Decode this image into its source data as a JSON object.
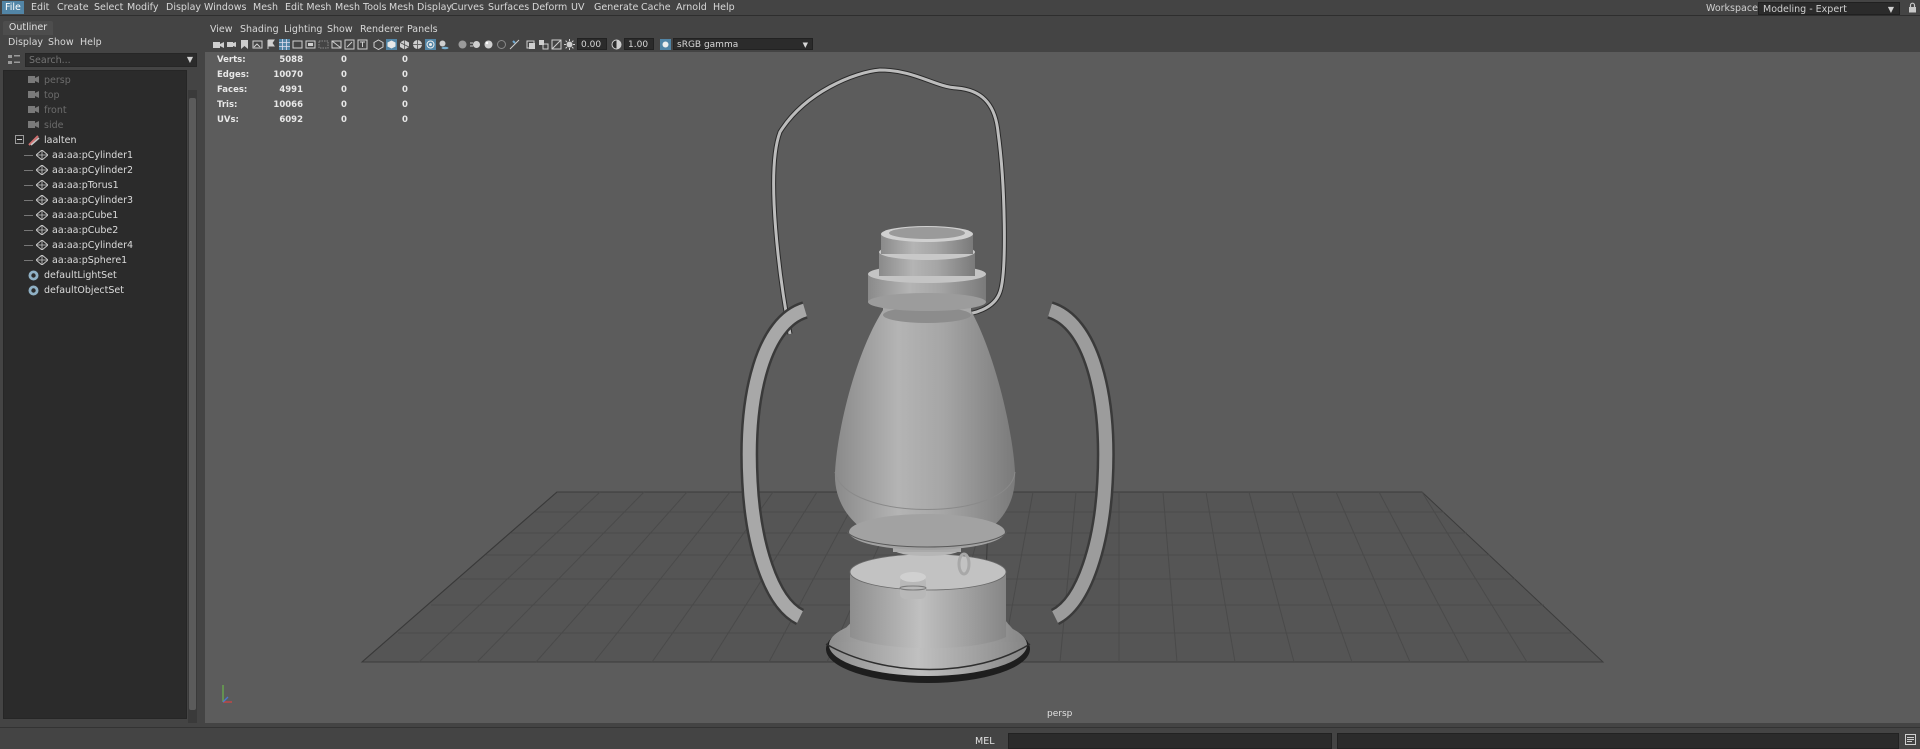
{
  "menubar": {
    "items": [
      "File",
      "Edit",
      "Create",
      "Select",
      "Modify",
      "Display",
      "Windows",
      "Mesh",
      "Edit Mesh",
      "Mesh Tools",
      "Mesh Display",
      "Curves",
      "Surfaces",
      "Deform",
      "UV",
      "Generate",
      "Cache",
      "Arnold",
      "Help"
    ],
    "workspace_label": "Workspace :",
    "workspace_value": "Modeling - Expert"
  },
  "outliner": {
    "tab": "Outliner",
    "menu": [
      "Display",
      "Show",
      "Help"
    ],
    "search_placeholder": "Search...",
    "cameras": [
      "persp",
      "top",
      "front",
      "side"
    ],
    "group": "laalten",
    "children": [
      "aa:aa:pCylinder1",
      "aa:aa:pCylinder2",
      "aa:aa:pTorus1",
      "aa:aa:pCylinder3",
      "aa:aa:pCube1",
      "aa:aa:pCube2",
      "aa:aa:pCylinder4",
      "aa:aa:pSphere1"
    ],
    "sets": [
      "defaultLightSet",
      "defaultObjectSet"
    ]
  },
  "viewport": {
    "menu": [
      "View",
      "Shading",
      "Lighting",
      "Show",
      "Renderer",
      "Panels"
    ],
    "exposure": "0.00",
    "gamma": "1.00",
    "color_space": "sRGB gamma",
    "camera_label": "persp",
    "hud": [
      {
        "label": "Verts:",
        "v1": "5088",
        "v2": "0",
        "v3": "0"
      },
      {
        "label": "Edges:",
        "v1": "10070",
        "v2": "0",
        "v3": "0"
      },
      {
        "label": "Faces:",
        "v1": "4991",
        "v2": "0",
        "v3": "0"
      },
      {
        "label": "Tris:",
        "v1": "10066",
        "v2": "0",
        "v3": "0"
      },
      {
        "label": "UVs:",
        "v1": "6092",
        "v2": "0",
        "v3": "0"
      }
    ]
  },
  "cmdline": {
    "lang": "MEL"
  },
  "colors": {
    "accent": "#5285a6",
    "panel": "#444444",
    "viewport_bg": "#5c5c5c",
    "field_bg": "#2b2b2b"
  }
}
